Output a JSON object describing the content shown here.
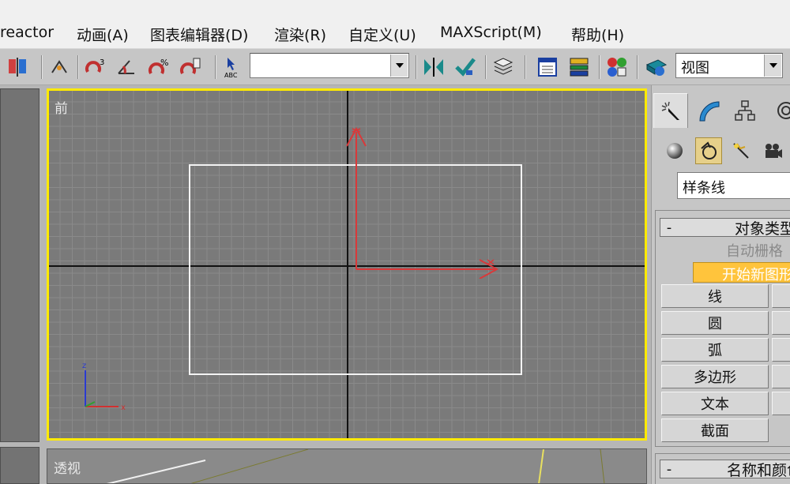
{
  "menubar": {
    "items": [
      {
        "label": "reactor"
      },
      {
        "label": "动画(A)"
      },
      {
        "label": "图表编辑器(D)"
      },
      {
        "label": "渲染(R)"
      },
      {
        "label": "自定义(U)"
      },
      {
        "label": "MAXScript(M)"
      },
      {
        "label": "帮助(H)"
      }
    ]
  },
  "toolbar": {
    "selection_set_value": "",
    "coord_system_value": "视图",
    "icons": [
      "mirror-icon",
      "snap-angle-icon",
      "snap-3d-icon",
      "snap-percent-icon",
      "spinner-snap-icon",
      "edit-named-selection-icon",
      "mirror-tool-icon",
      "align-icon",
      "layer-manager-icon",
      "curve-editor-icon",
      "schematic-view-icon",
      "material-editor-icon",
      "render-scene-icon"
    ]
  },
  "viewports": {
    "front_label": "前",
    "perspective_label": "透视",
    "active_border_color": "#ffea00",
    "gizmo_color": "#d9393a"
  },
  "command_panel": {
    "tabs": [
      "create-tab",
      "modify-tab",
      "hierarchy-tab",
      "motion-tab"
    ],
    "categories": [
      "geometry-icon",
      "shapes-icon",
      "lights-icon",
      "cameras-icon"
    ],
    "subcategory_value": "样条线",
    "object_type_rollout": {
      "title": "对象类型",
      "autogrid_label": "自动栅格",
      "start_new_shape_label": "开始新图形",
      "buttons": [
        "线",
        "圆",
        "弧",
        "多边形",
        "文本",
        "截面"
      ]
    },
    "name_color_rollout": {
      "title": "名称和颜色"
    }
  }
}
